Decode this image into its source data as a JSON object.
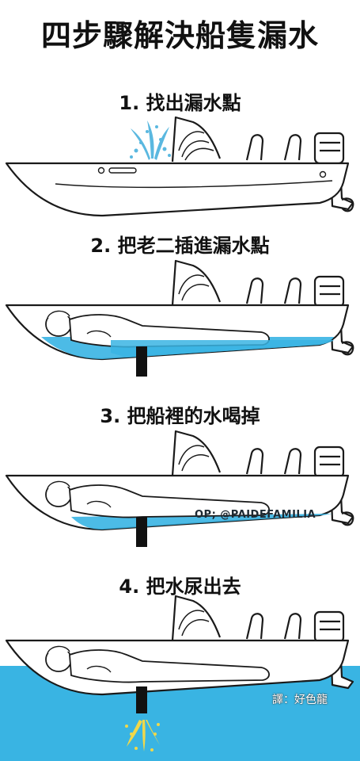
{
  "title": "四步驟解決船隻漏水",
  "steps": [
    {
      "label": "1. 找出漏水點"
    },
    {
      "label": "2. 把老二插進漏水點"
    },
    {
      "label": "3. 把船裡的水喝掉"
    },
    {
      "label": "4. 把水尿出去"
    }
  ],
  "credits": {
    "source": "OP; @PAIDEFAMILIA",
    "translator": "譯：好色龍"
  },
  "colors": {
    "water": "#39b4e3",
    "hull_line": "#1a1a1a",
    "leak_spray": "#5ab8e0",
    "pee_spray": "#f0d84a",
    "plug": "#111111"
  }
}
